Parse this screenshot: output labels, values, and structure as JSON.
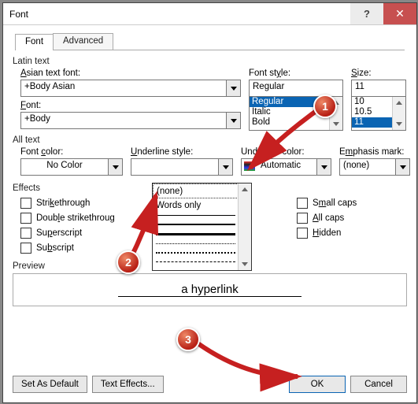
{
  "titlebar": {
    "title": "Font"
  },
  "tabs": {
    "font": "Font",
    "advanced": "Advanced"
  },
  "latin": {
    "heading": "Latin text",
    "asianLabel": "Asian text font:",
    "asianValue": "+Body Asian",
    "fontLabel": "Font:",
    "fontValue": "+Body",
    "styleLabel": "Font style:",
    "styleValue": "Regular",
    "styleOptions": [
      "Regular",
      "Italic",
      "Bold"
    ],
    "sizeLabel": "Size:",
    "sizeValue": "11",
    "sizeOptions": [
      "10",
      "10.5",
      "11"
    ]
  },
  "alltext": {
    "heading": "All text",
    "colorLabel": "Font color:",
    "colorValue": "No Color",
    "ulStyleLabel": "Underline style:",
    "ulColorLabel": "Underline color:",
    "ulColorValue": "Automatic",
    "emphLabel": "Emphasis mark:",
    "emphValue": "(none)",
    "dd": {
      "none": "(none)",
      "words": "Words only"
    }
  },
  "effects": {
    "heading": "Effects",
    "strike": "Strikethrough",
    "dstrike": "Double strikethroug",
    "superscript": "Superscript",
    "subscript": "Subscript",
    "smallcaps": "Small caps",
    "allcaps": "All caps",
    "hidden": "Hidden"
  },
  "preview": {
    "heading": "Preview",
    "text": "a hyperlink"
  },
  "footer": {
    "default": "Set As Default",
    "effects": "Text Effects...",
    "ok": "OK",
    "cancel": "Cancel"
  },
  "anno": {
    "a1": "1",
    "a2": "2",
    "a3": "3"
  }
}
